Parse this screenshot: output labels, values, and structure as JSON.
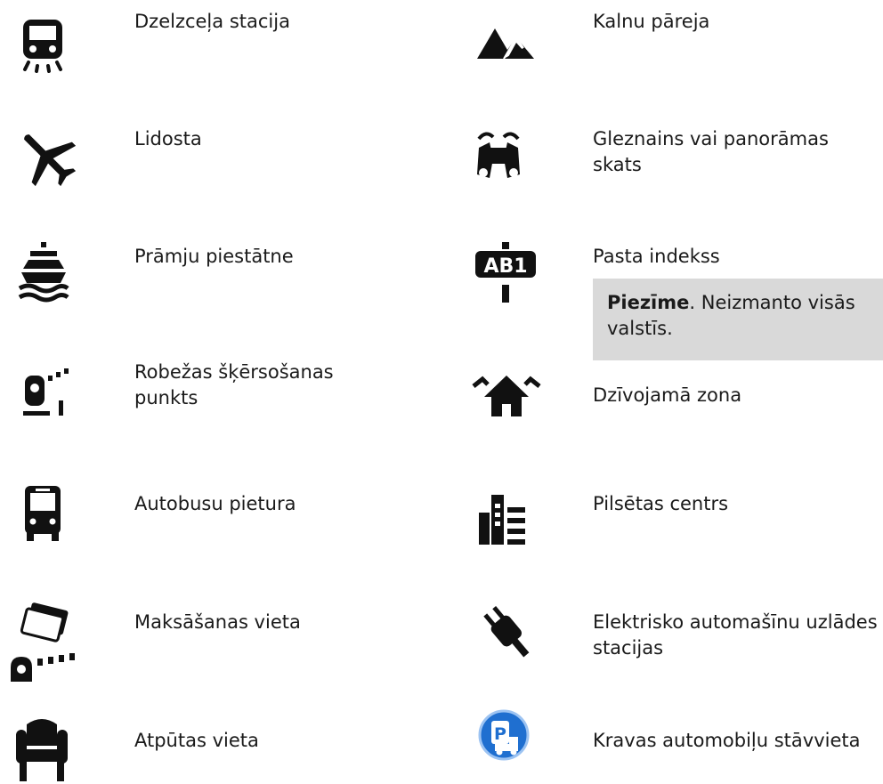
{
  "left_items": [
    {
      "label": "Dzelzceļa stacija",
      "icon": "train-station-icon"
    },
    {
      "label": "Lidosta",
      "icon": "airplane-icon"
    },
    {
      "label": "Prāmju piestātne",
      "icon": "ferry-icon"
    },
    {
      "label": "Robežas šķērsošanas punkts",
      "icon": "border-crossing-icon"
    },
    {
      "label": "Autobusu pietura",
      "icon": "bus-stop-icon"
    },
    {
      "label": "Maksāšanas vieta",
      "icon": "toll-gate-icon"
    },
    {
      "label": "Atpūtas vieta",
      "icon": "rest-area-armchair-icon"
    }
  ],
  "right_items": [
    {
      "label": "Kalnu pāreja",
      "icon": "mountain-pass-icon"
    },
    {
      "label": "Gleznains vai panorāmas skats",
      "icon": "binoculars-icon"
    },
    {
      "label": "Pasta indekss",
      "icon": "postcode-sign-icon"
    },
    {
      "label": "Dzīvojamā zona",
      "icon": "residential-area-icon"
    },
    {
      "label": "Pilsētas centrs",
      "icon": "city-centre-icon"
    },
    {
      "label": "Elektrisko automašīnu uzlādes stacijas",
      "icon": "ev-charging-plug-icon"
    },
    {
      "label": "Kravas automobiļu stāvvieta",
      "icon": "truck-parking-icon"
    }
  ],
  "note": {
    "bold": "Piezīme",
    "text": ". Neizmanto visās valstīs."
  },
  "colors": {
    "icon": "#111111",
    "note_bg": "#d9d9d9",
    "truck_parking_blue": "#1f6fd0"
  }
}
